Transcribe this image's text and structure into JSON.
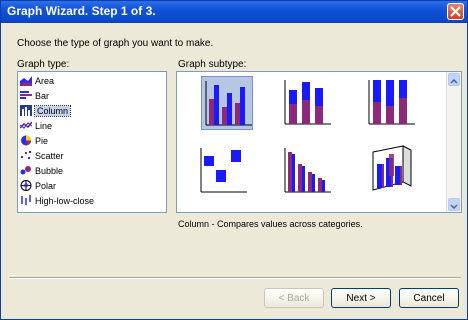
{
  "window": {
    "title": "Graph Wizard. Step 1 of 3."
  },
  "instruction": "Choose the type of graph you want to make.",
  "graph_type_label": "Graph type:",
  "graph_subtype_label": "Graph subtype:",
  "graph_types": [
    {
      "label": "Area",
      "icon": "area-chart-icon"
    },
    {
      "label": "Bar",
      "icon": "bar-chart-icon"
    },
    {
      "label": "Column",
      "icon": "column-chart-icon",
      "selected": true
    },
    {
      "label": "Line",
      "icon": "line-chart-icon"
    },
    {
      "label": "Pie",
      "icon": "pie-chart-icon"
    },
    {
      "label": "Scatter",
      "icon": "scatter-chart-icon"
    },
    {
      "label": "Bubble",
      "icon": "bubble-chart-icon"
    },
    {
      "label": "Polar",
      "icon": "polar-chart-icon"
    },
    {
      "label": "High-low-close",
      "icon": "high-low-close-icon"
    }
  ],
  "subtype_description": "Column - Compares values across categories.",
  "buttons": {
    "back": "< Back",
    "next": "Next >",
    "cancel": "Cancel"
  },
  "colors": {
    "title_bar": "#0b49cc",
    "series_blue": "#1a1aff",
    "series_purple": "#8b2a7a",
    "selection": "#b7c6e2"
  }
}
